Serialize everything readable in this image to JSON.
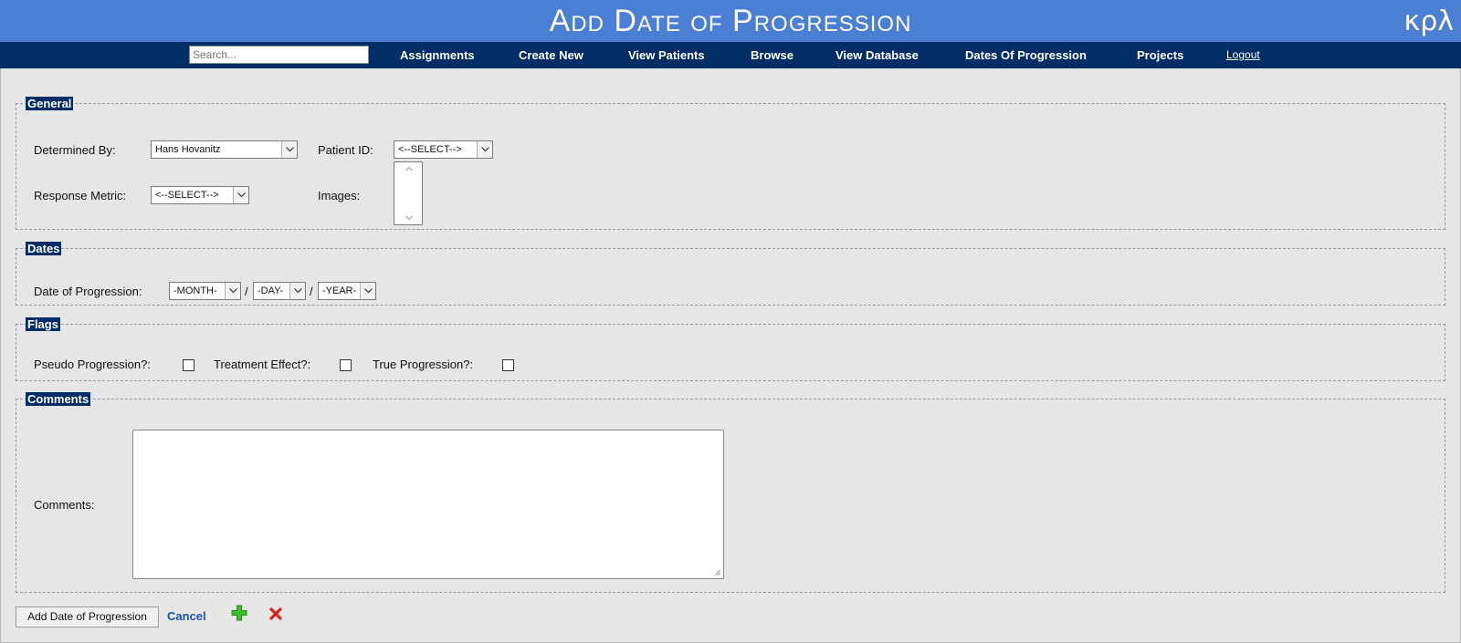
{
  "header": {
    "title": "Add Date of Progression",
    "logo_text": "κρλ"
  },
  "nav": {
    "search_placeholder": "Search...",
    "items": [
      "Assignments",
      "Create New",
      "View Patients",
      "Browse",
      "View Database",
      "Dates Of Progression",
      "Projects"
    ],
    "logout": "Logout"
  },
  "general": {
    "legend": "General",
    "determined_by_label": "Determined By:",
    "determined_by_value": "Hans Hovanitz",
    "patient_id_label": "Patient ID:",
    "patient_id_value": "<--SELECT-->",
    "response_metric_label": "Response Metric:",
    "response_metric_value": "<--SELECT-->",
    "images_label": "Images:"
  },
  "dates": {
    "legend": "Dates",
    "date_label": "Date of Progression:",
    "month": "-MONTH-",
    "day": "-DAY-",
    "year": "-YEAR-",
    "separator": "/"
  },
  "flags": {
    "legend": "Flags",
    "pseudo_label": "Pseudo Progression?:",
    "treatment_label": "Treatment Effect?:",
    "true_label": "True Progression?:"
  },
  "comments": {
    "legend": "Comments",
    "label": "Comments:",
    "value": ""
  },
  "actions": {
    "submit_label": "Add Date of Progression",
    "cancel_label": "Cancel"
  },
  "colors": {
    "title_bar": "#4a7fd3",
    "nav_bar": "#002d66",
    "page_bg": "#e6e6e6",
    "cancel_link": "#1a55a8"
  }
}
